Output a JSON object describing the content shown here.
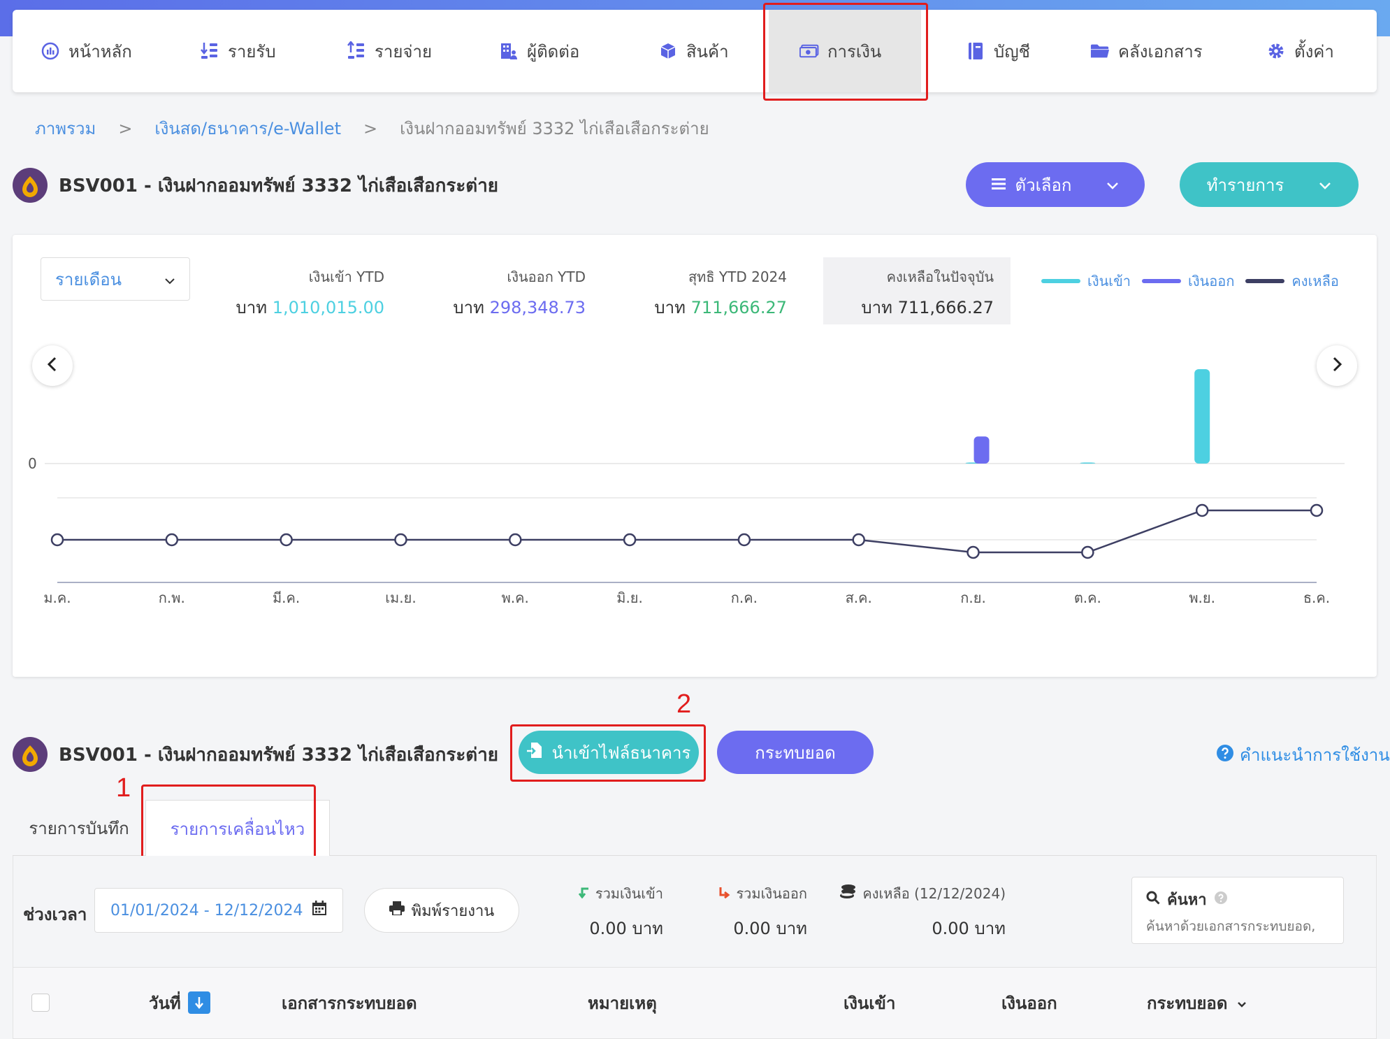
{
  "nav": {
    "items": [
      {
        "label": "หน้าหลัก",
        "icon": "dashboard-icon"
      },
      {
        "label": "รายรับ",
        "icon": "income-list-icon"
      },
      {
        "label": "รายจ่าย",
        "icon": "expense-list-icon"
      },
      {
        "label": "ผู้ติดต่อ",
        "icon": "contacts-icon"
      },
      {
        "label": "สินค้า",
        "icon": "box-icon"
      },
      {
        "label": "การเงิน",
        "icon": "money-icon"
      },
      {
        "label": "บัญชี",
        "icon": "ledger-icon"
      },
      {
        "label": "คลังเอกสาร",
        "icon": "folder-icon"
      },
      {
        "label": "ตั้งค่า",
        "icon": "gear-icon"
      }
    ],
    "active_label": "การเงิน"
  },
  "breadcrumb": {
    "items": [
      "ภาพรวม",
      "เงินสด/ธนาคาร/e-Wallet"
    ],
    "separator": ">",
    "current": "เงินฝากออมทรัพย์ 3332 ไก่เสือเสือกระต่าย"
  },
  "account": {
    "title": "BSV001 - เงินฝากออมทรัพย์ 3332 ไก่เสือเสือกระต่าย"
  },
  "header_actions": {
    "options_label": "ตัวเลือก",
    "transaction_label": "ทำรายการ"
  },
  "summary": {
    "period_select": "รายเดือน",
    "currency": "บาท",
    "income": {
      "label": "เงินเข้า YTD",
      "value": "1,010,015.00"
    },
    "expense": {
      "label": "เงินออก YTD",
      "value": "298,348.73"
    },
    "net": {
      "label": "สุทธิ YTD 2024",
      "value": "711,666.27"
    },
    "balance": {
      "label": "คงเหลือในปัจจุบัน",
      "value": "711,666.27"
    }
  },
  "colors": {
    "income": "#4dd0e1",
    "expense": "#6c6cf0",
    "balance": "#3d3f63",
    "net_value": "#3cb878",
    "accent": "#6c6cf0",
    "teal": "#3fc3c7",
    "annotation": "#e11d1d"
  },
  "chart_data": {
    "type": "bar",
    "categories": [
      "ม.ค.",
      "ก.พ.",
      "มี.ค.",
      "เม.ย.",
      "พ.ค.",
      "มิ.ย.",
      "ก.ค.",
      "ส.ค.",
      "ก.ย.",
      "ต.ค.",
      "พ.ย.",
      "ธ.ค."
    ],
    "y_tick_labels": [
      "0"
    ],
    "series": [
      {
        "name": "เงินเข้า",
        "values": [
          0,
          0,
          0,
          0,
          0,
          0,
          0,
          0,
          8000,
          15,
          1010000,
          0
        ]
      },
      {
        "name": "เงินออก",
        "values": [
          0,
          0,
          0,
          0,
          0,
          0,
          0,
          0,
          290000,
          0,
          0,
          0
        ]
      },
      {
        "name": "คงเหลือ",
        "type": "line",
        "values": [
          0,
          0,
          0,
          0,
          0,
          0,
          0,
          0,
          -282000,
          -282000,
          711666.27,
          711666.27
        ]
      }
    ],
    "legend_position": "top-right",
    "grid": true
  },
  "section2": {
    "import_button": "นำเข้าไฟล์ธนาคาร",
    "reconcile_button": "กระทบยอด",
    "help_link": "คำแนะนำการใช้งาน",
    "annotation_1": "1",
    "annotation_2": "2"
  },
  "tabs": [
    {
      "label": "รายการบันทึก",
      "active": false
    },
    {
      "label": "รายการเคลื่อนไหว",
      "active": true
    }
  ],
  "filters": {
    "period_label": "ช่วงเวลา",
    "date_range": "01/01/2024 - 12/12/2024",
    "print_label": "พิมพ์รายงาน",
    "total_in_label": "รวมเงินเข้า",
    "total_in_value": "0.00 บาท",
    "total_out_label": "รวมเงินออก",
    "total_out_value": "0.00 บาท",
    "balance_label": "คงเหลือ (12/12/2024)",
    "balance_value": "0.00 บาท",
    "search_label": "ค้นหา",
    "search_placeholder": "ค้นหาด้วยเอกสารกระทบยอด,"
  },
  "table": {
    "columns": [
      "วันที่",
      "เอกสารกระทบยอด",
      "หมายเหตุ",
      "เงินเข้า",
      "เงินออก",
      "กระทบยอด"
    ]
  }
}
